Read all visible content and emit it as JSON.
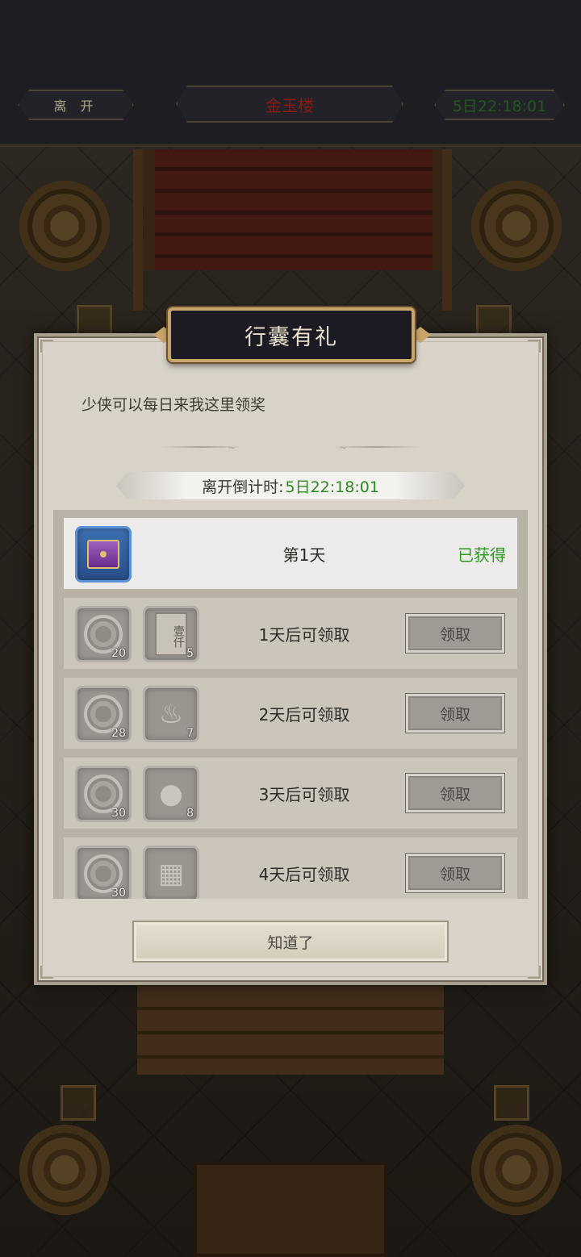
{
  "topbar": {
    "leave_label": "离 开",
    "title": "金玉楼",
    "timer": "5日22:18:01"
  },
  "dialog": {
    "title": "行囊有礼",
    "intro": "少侠可以每日来我这里领奖",
    "countdown_label": "离开倒计时:",
    "countdown_value": "5日22:18:01",
    "confirm_label": "知道了"
  },
  "rewards": [
    {
      "label": "第1天",
      "status": "已获得",
      "items": [
        {
          "icon": "treasure-chest-icon",
          "count": ""
        }
      ]
    },
    {
      "label": "1天后可领取",
      "button": "领取",
      "items": [
        {
          "icon": "silver-coin-icon",
          "count": "20"
        },
        {
          "icon": "scroll-icon",
          "count": "5",
          "text": "壹仟"
        }
      ]
    },
    {
      "label": "2天后可领取",
      "button": "领取",
      "items": [
        {
          "icon": "silver-coin-icon",
          "count": "28"
        },
        {
          "icon": "incense-burner-icon",
          "count": "7"
        }
      ]
    },
    {
      "label": "3天后可领取",
      "button": "领取",
      "items": [
        {
          "icon": "silver-coin-icon",
          "count": "30"
        },
        {
          "icon": "crystal-ball-icon",
          "count": "8"
        }
      ]
    },
    {
      "label": "4天后可领取",
      "button": "领取",
      "items": [
        {
          "icon": "silver-coin-icon",
          "count": "30"
        },
        {
          "icon": "cabinet-icon",
          "count": ""
        }
      ]
    }
  ],
  "colors": {
    "accent_green": "#2a9a1e",
    "title_red": "#8a1a12",
    "plate_gold": "#c8a66a"
  }
}
